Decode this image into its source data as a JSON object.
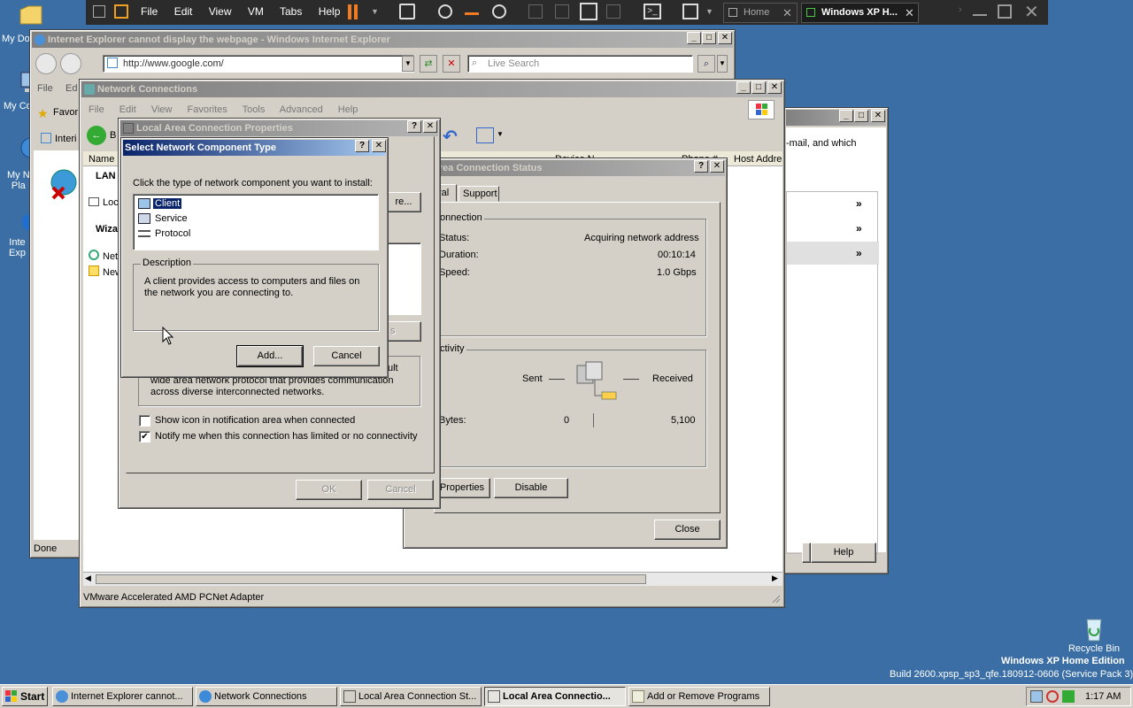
{
  "vmware": {
    "menus": [
      "File",
      "Edit",
      "View",
      "VM",
      "Tabs",
      "Help"
    ],
    "tabs": [
      {
        "label": "Home"
      },
      {
        "label": "Windows XP H..."
      }
    ]
  },
  "desktop": {
    "icons": [
      "My Do",
      "My Co",
      "My N\nPla",
      "Inte\nExp"
    ],
    "recycle_bin": "Recycle Bin",
    "watermark_title": "Windows XP Home Edition",
    "watermark_build": "Build 2600.xpsp_sp3_qfe.180912-0606 (Service Pack 3)"
  },
  "ie": {
    "title": "Internet Explorer cannot display the webpage - Windows Internet Explorer",
    "address": "http://www.google.com/",
    "search_placeholder": "Live Search",
    "menu_file": "File",
    "menu_edit": "Ed",
    "favorites": "Favor",
    "tab_label": "Interi",
    "status": "Done"
  },
  "netconn": {
    "title": "Network Connections",
    "menus": [
      "File",
      "Edit",
      "View",
      "Favorites",
      "Tools",
      "Advanced",
      "Help"
    ],
    "col_name": "Name",
    "col_host": "Host Addre",
    "col_device": "Device N",
    "col_phone": "Phone #",
    "group_lan": "LAN",
    "item_local": "Loc",
    "group_wizard": "Wiza",
    "wiz_item1": "Net",
    "wiz_item2": "New",
    "back_label": "B",
    "statusbar": "VMware Accelerated AMD PCNet Adapter"
  },
  "addremove": {
    "text": "-mail, and which",
    "help_button": "Help"
  },
  "status_dialog": {
    "title": "al Area Connection Status",
    "tab_general": "ral",
    "tab_support": "Support",
    "connection_group": "onnection",
    "status_label": "Status:",
    "status_value": "Acquiring network address",
    "duration_label": "Duration:",
    "duration_value": "00:10:14",
    "speed_label": "Speed:",
    "speed_value": "1.0 Gbps",
    "activity_group": "ctivity",
    "sent_label": "Sent",
    "received_label": "Received",
    "bytes_label": "Bytes:",
    "bytes_sent": "0",
    "bytes_received": "5,100",
    "properties_button": "Properties",
    "disable_button": "Disable",
    "close_button": "Close"
  },
  "lac_properties": {
    "title": "Local Area Connection Properties",
    "config_button": "re...",
    "desc_line1": "wide area network protocol that provides communication",
    "desc_line2": "across diverse interconnected networks.",
    "desc_fragment": "ult",
    "show_icon_label": "Show icon in notification area when connected",
    "show_icon_checked": false,
    "notify_label": "Notify me when this connection has limited or no connectivity",
    "notify_checked": true,
    "ok_button": "OK",
    "cancel_button": "Cancel",
    "props_fragment": "s"
  },
  "select_component": {
    "title": "Select Network Component Type",
    "prompt": "Click the type of network component you want to install:",
    "items": [
      "Client",
      "Service",
      "Protocol"
    ],
    "selected_index": 0,
    "description_label": "Description",
    "description_text": "A client provides access to computers and files on\nthe network you are connecting to.",
    "add_button": "Add...",
    "cancel_button": "Cancel"
  },
  "taskbar": {
    "start": "Start",
    "buttons": [
      "Internet Explorer cannot...",
      "Network Connections",
      "Local Area Connection St...",
      "Local Area Connectio...",
      "Add or Remove Programs"
    ],
    "active_index": 3,
    "clock": "1:17 AM"
  },
  "colors": {
    "desktop": "#3a6ea5",
    "xp_title_active": "#0a246a",
    "selection": "#0a246a"
  }
}
